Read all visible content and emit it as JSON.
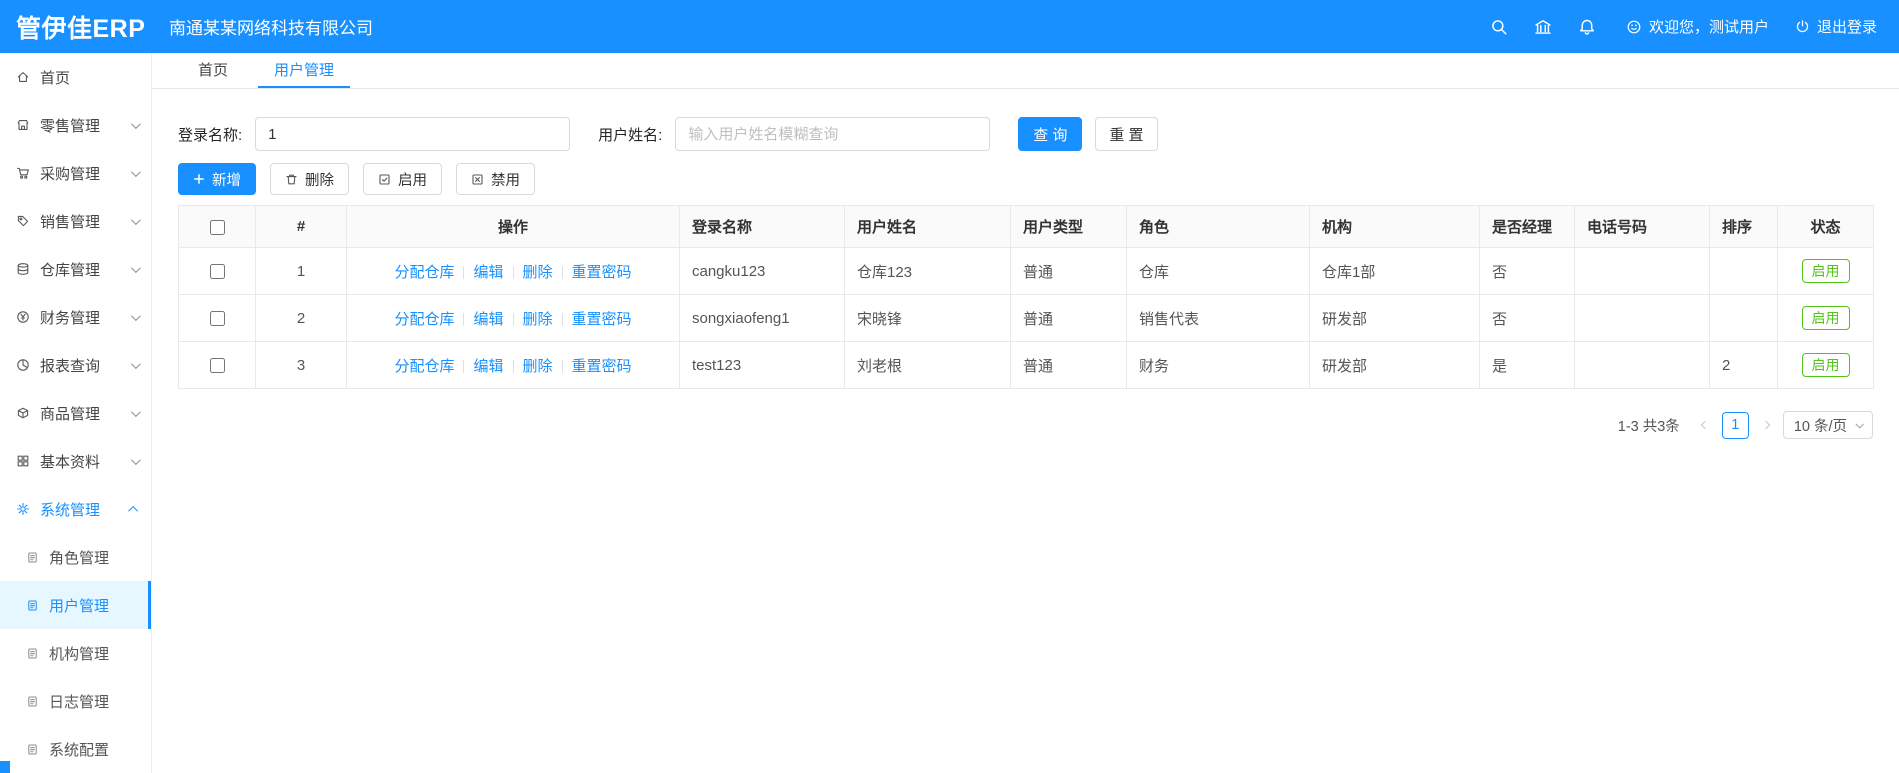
{
  "header": {
    "logo": "管伊佳ERP",
    "company": "南通某某网络科技有限公司",
    "welcome": "欢迎您，测试用户",
    "logout": "退出登录"
  },
  "sidebar": {
    "items": [
      {
        "label": "首页"
      },
      {
        "label": "零售管理"
      },
      {
        "label": "采购管理"
      },
      {
        "label": "销售管理"
      },
      {
        "label": "仓库管理"
      },
      {
        "label": "财务管理"
      },
      {
        "label": "报表查询"
      },
      {
        "label": "商品管理"
      },
      {
        "label": "基本资料"
      },
      {
        "label": "系统管理"
      }
    ],
    "sub_items": [
      {
        "label": "角色管理"
      },
      {
        "label": "用户管理"
      },
      {
        "label": "机构管理"
      },
      {
        "label": "日志管理"
      },
      {
        "label": "系统配置"
      }
    ]
  },
  "tabs": {
    "home": "首页",
    "current": "用户管理"
  },
  "filters": {
    "login_name_label": "登录名称:",
    "login_name_value": "1",
    "user_name_label": "用户姓名:",
    "user_name_placeholder": "输入用户姓名模糊查询",
    "search_button": "查 询",
    "reset_button": "重 置"
  },
  "toolbar": {
    "add": "新增",
    "delete": "删除",
    "enable": "启用",
    "disable": "禁用"
  },
  "table": {
    "columns": [
      "#",
      "操作",
      "登录名称",
      "用户姓名",
      "用户类型",
      "角色",
      "机构",
      "是否经理",
      "电话号码",
      "排序",
      "状态"
    ],
    "action_links": {
      "assign": "分配仓库",
      "edit": "编辑",
      "delete": "删除",
      "reset_pwd": "重置密码"
    },
    "rows": [
      {
        "index": "1",
        "login_name": "cangku123",
        "user_name": "仓库123",
        "user_type": "普通",
        "role": "仓库",
        "org": "仓库1部",
        "is_manager": "否",
        "phone": "",
        "sort": "",
        "status": "启用"
      },
      {
        "index": "2",
        "login_name": "songxiaofeng1",
        "user_name": "宋晓锋",
        "user_type": "普通",
        "role": "销售代表",
        "org": "研发部",
        "is_manager": "否",
        "phone": "",
        "sort": "",
        "status": "启用"
      },
      {
        "index": "3",
        "login_name": "test123",
        "user_name": "刘老根",
        "user_type": "普通",
        "role": "财务",
        "org": "研发部",
        "is_manager": "是",
        "phone": "",
        "sort": "2",
        "status": "启用"
      }
    ]
  },
  "pagination": {
    "total_text": "1-3 共3条",
    "current_page": "1",
    "page_size": "10 条/页"
  },
  "colors": {
    "primary": "#1890ff",
    "success": "#52c41a",
    "active_menu_bg": "#e6f7ff",
    "border": "#e9e9e9",
    "table_header_bg": "#fafafa"
  },
  "icons": {
    "search-icon": "magnifier",
    "bank-icon": "building",
    "bell-icon": "bell",
    "user-circle-icon": "smile-circle",
    "logout-icon": "power",
    "plus-icon": "+",
    "trash-icon": "trash",
    "check-square-icon": "checked-square",
    "x-square-icon": "crossed-square",
    "chevron-down-icon": "v",
    "chevron-up-icon": "^",
    "chevron-left-icon": "<",
    "chevron-right-icon": ">"
  }
}
